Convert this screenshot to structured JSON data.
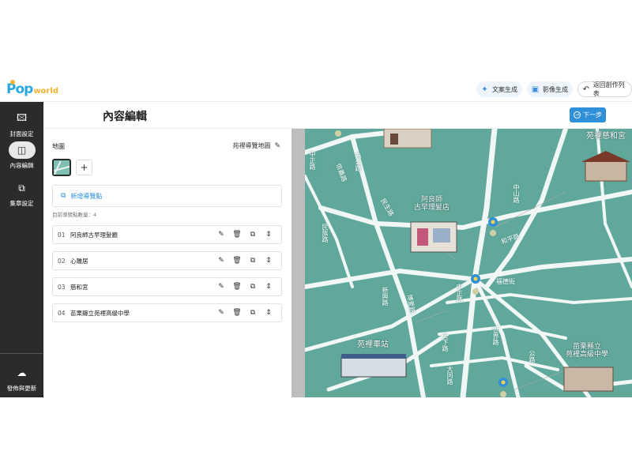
{
  "app": {
    "logo_main": "Pop",
    "logo_sub": "world"
  },
  "topbar": {
    "copy_gen": "文案生成",
    "image_gen": "影像生成",
    "back_label": "返回創作列表"
  },
  "sidebar": {
    "items": [
      {
        "label": "封面設定",
        "icon": "image-icon"
      },
      {
        "label": "內容編輯",
        "icon": "book-icon"
      },
      {
        "label": "集章設定",
        "icon": "stamp-icon"
      }
    ],
    "publish_label": "發佈與更新"
  },
  "header": {
    "title": "內容編輯",
    "next_label": "下一步"
  },
  "editor": {
    "map_label": "地圖",
    "map_name": "苑裡導覽地圖",
    "add_map_symbol": "+",
    "new_point_label": "新增導覽點",
    "count_label": "目前導覽點數量：4",
    "points": [
      {
        "num": "01",
        "name": "阿良師古早理髮廳"
      },
      {
        "num": "02",
        "name": "心雕居"
      },
      {
        "num": "03",
        "name": "慈和宮"
      },
      {
        "num": "04",
        "name": "苗栗縣立苑裡高級中學"
      }
    ]
  },
  "map": {
    "landmarks": [
      {
        "label": "苑裡慈和宮"
      },
      {
        "label": "阿良師\n古早理髮店"
      },
      {
        "label": "苑裡車站"
      },
      {
        "label": "苗栗縣立\n苑裡高級中學"
      }
    ],
    "streets": [
      "中山路",
      "中正路",
      "民生路",
      "天下路",
      "大同路",
      "世界路",
      "福德街",
      "和平路",
      "為公路",
      "信義路",
      "民族路",
      "新興路",
      "博愛路",
      "中正路",
      "公路"
    ],
    "colors": {
      "water": "#5fa89b",
      "road": "#f1f7f5",
      "pin": "#2f8fd8"
    }
  }
}
